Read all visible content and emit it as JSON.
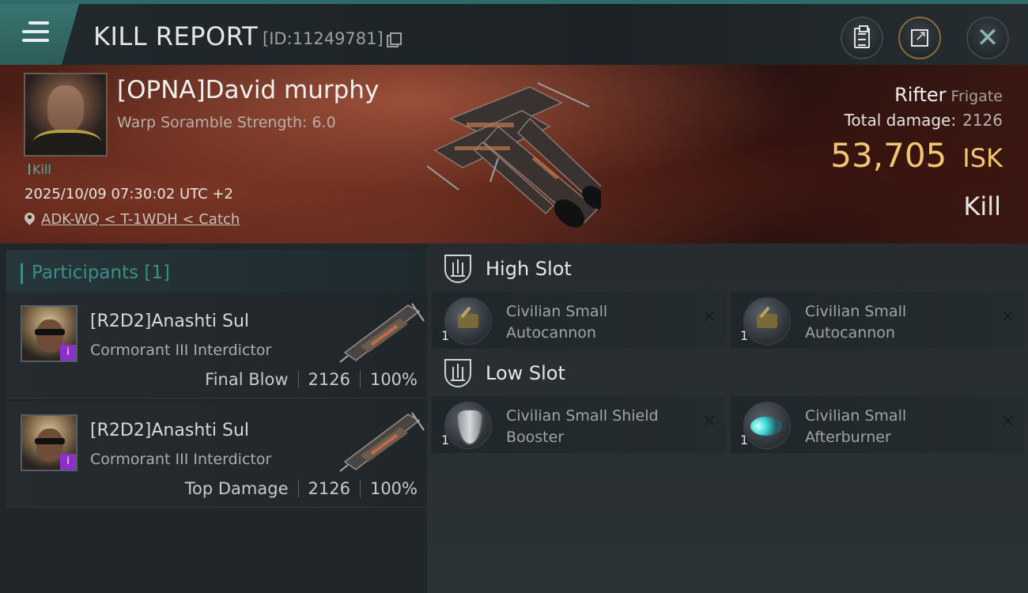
{
  "header": {
    "title": "KILL REPORT",
    "id_text": "[ID:11249781]"
  },
  "victim": {
    "name": "[OPNA]David murphy",
    "scramble": "Warp Soramble Strength: 6.0",
    "tag": "Kill",
    "datetime": "2025/10/09 07:30:02 UTC +2",
    "location": "ADK-WQ < T-1WDH < Catch",
    "ship_name": "Rifter",
    "ship_class": "Frigate",
    "total_damage_label": "Total damage:",
    "total_damage_value": "2126",
    "isk_value": "53,705",
    "isk_unit": "ISK",
    "result": "Kill"
  },
  "participants": {
    "header": "Participants [1]",
    "rows": [
      {
        "name": "[R2D2]Anashti Sul",
        "ship": "Cormorant III Interdictor",
        "role": "Final Blow",
        "damage": "2126",
        "percent": "100%"
      },
      {
        "name": "[R2D2]Anashti Sul",
        "ship": "Cormorant III Interdictor",
        "role": "Top Damage",
        "damage": "2126",
        "percent": "100%"
      }
    ]
  },
  "fittings": {
    "high_slot_label": "High Slot",
    "low_slot_label": "Low Slot",
    "high": [
      {
        "qty": "1",
        "name": "Civilian Small Autocannon",
        "icon": "autocannon-icon"
      },
      {
        "qty": "1",
        "name": "Civilian Small Autocannon",
        "icon": "autocannon-icon"
      }
    ],
    "low": [
      {
        "qty": "1",
        "name": "Civilian Small Shield Booster",
        "icon": "shield-booster-icon"
      },
      {
        "qty": "1",
        "name": "Civilian Small Afterburner",
        "icon": "afterburner-icon"
      }
    ],
    "close_symbol": "✕"
  },
  "colors": {
    "accent_teal": "#3f8c88",
    "isk_gold": "#f2c66e",
    "banner_red": "#5a2a1e"
  }
}
